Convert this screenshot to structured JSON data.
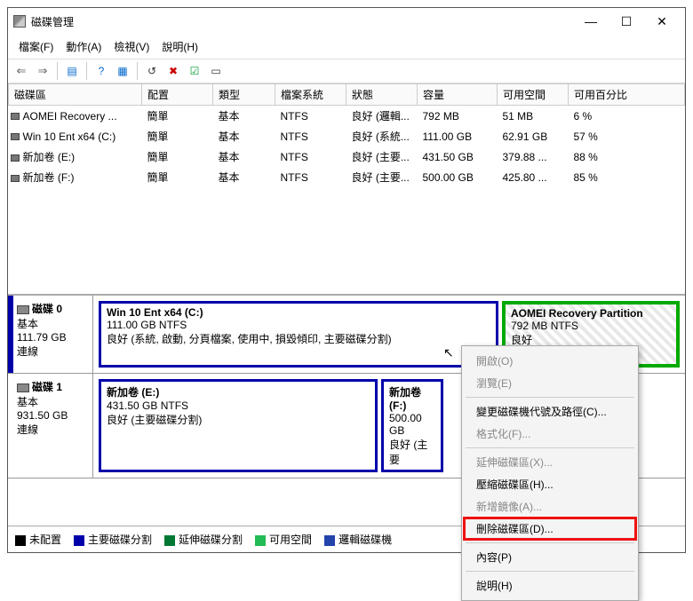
{
  "window": {
    "title": "磁碟管理"
  },
  "menu": {
    "file": "檔案(F)",
    "action": "動作(A)",
    "view": "檢視(V)",
    "help": "說明(H)"
  },
  "cols": {
    "vol": "磁碟區",
    "layout": "配置",
    "type": "類型",
    "fs": "檔案系統",
    "state": "狀態",
    "cap": "容量",
    "free": "可用空間",
    "pct": "可用百分比"
  },
  "rows": [
    {
      "vol": "AOMEI Recovery ...",
      "layout": "簡單",
      "type": "基本",
      "fs": "NTFS",
      "state": "良好 (邏輯...",
      "cap": "792 MB",
      "free": "51 MB",
      "pct": "6 %"
    },
    {
      "vol": "Win 10 Ent x64 (C:)",
      "layout": "簡單",
      "type": "基本",
      "fs": "NTFS",
      "state": "良好 (系統...",
      "cap": "111.00 GB",
      "free": "62.91 GB",
      "pct": "57 %"
    },
    {
      "vol": "新加卷 (E:)",
      "layout": "簡單",
      "type": "基本",
      "fs": "NTFS",
      "state": "良好 (主要...",
      "cap": "431.50 GB",
      "free": "379.88 ...",
      "pct": "88 %"
    },
    {
      "vol": "新加卷 (F:)",
      "layout": "簡單",
      "type": "基本",
      "fs": "NTFS",
      "state": "良好 (主要...",
      "cap": "500.00 GB",
      "free": "425.80 ...",
      "pct": "85 %"
    }
  ],
  "disk0": {
    "title": "磁碟 0",
    "type": "基本",
    "size": "111.79 GB",
    "status": "連線",
    "p1": {
      "t": "Win 10 Ent x64  (C:)",
      "s": "111.00 GB NTFS",
      "d": "良好 (系統, 啟動, 分頁檔案, 使用中, 損毀傾印, 主要磁碟分割)"
    },
    "p2": {
      "t": "AOMEI Recovery Partition",
      "s": "792 MB NTFS",
      "d": "良好"
    }
  },
  "disk1": {
    "title": "磁碟 1",
    "type": "基本",
    "size": "931.50 GB",
    "status": "連線",
    "p1": {
      "t": "新加卷 (E:)",
      "s": "431.50 GB NTFS",
      "d": "良好 (主要磁碟分割)"
    },
    "p2": {
      "t": "新加卷 (F:)",
      "s": "500.00 GB",
      "d": "良好 (主要"
    }
  },
  "legend": {
    "unalloc": "未配置",
    "primary": "主要磁碟分割",
    "ext": "延伸磁碟分割",
    "free": "可用空間",
    "logical": "邏輯磁碟機"
  },
  "ctx": {
    "open": "開啟(O)",
    "explore": "瀏覽(E)",
    "chdrive": "變更磁碟機代號及路徑(C)...",
    "fmt": "格式化(F)...",
    "extend": "延伸磁碟區(X)...",
    "shrink": "壓縮磁碟區(H)...",
    "mirror": "新增鏡像(A)...",
    "del": "刪除磁碟區(D)...",
    "prop": "內容(P)",
    "help": "說明(H)"
  }
}
